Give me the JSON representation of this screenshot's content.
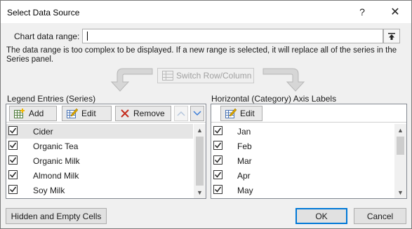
{
  "window": {
    "title": "Select Data Source",
    "help_label": "?",
    "close_label": "✕"
  },
  "chart_range": {
    "label": "Chart data range:",
    "value": ""
  },
  "message": "The data range is too complex to be displayed. If a new range is selected, it will replace all of the series in the Series panel.",
  "switch_button": {
    "label": "Switch Row/Column"
  },
  "legend": {
    "section_label": "Legend Entries (Series)",
    "add_label": "Add",
    "edit_label": "Edit",
    "remove_label": "Remove",
    "items": [
      {
        "label": "Cider",
        "checked": true
      },
      {
        "label": "Organic Tea",
        "checked": true
      },
      {
        "label": "Organic Milk",
        "checked": true
      },
      {
        "label": "Almond Milk",
        "checked": true
      },
      {
        "label": "Soy Milk",
        "checked": true
      }
    ]
  },
  "axis": {
    "section_label": "Horizontal (Category) Axis Labels",
    "edit_label": "Edit",
    "items": [
      {
        "label": "Jan",
        "checked": true
      },
      {
        "label": "Feb",
        "checked": true
      },
      {
        "label": "Mar",
        "checked": true
      },
      {
        "label": "Apr",
        "checked": true
      },
      {
        "label": "May",
        "checked": true
      }
    ]
  },
  "buttons": {
    "hidden_empty_label": "Hidden and Empty Cells",
    "ok_label": "OK",
    "cancel_label": "Cancel"
  },
  "colors": {
    "accent": "#0078d7",
    "remove_icon": "#c42b1c",
    "move_arrow": "#4a90d9"
  }
}
